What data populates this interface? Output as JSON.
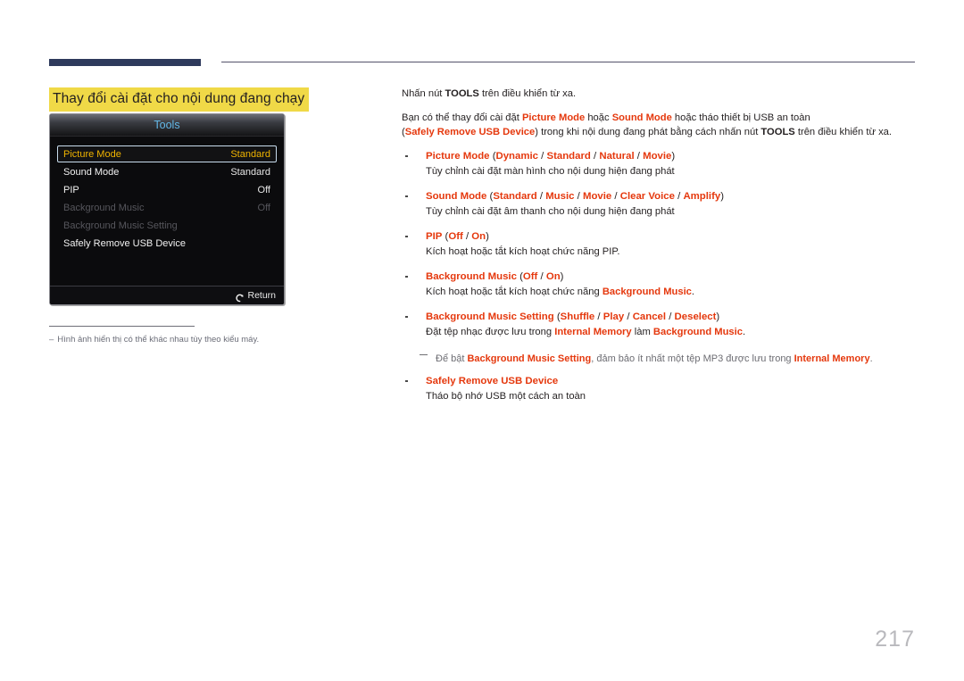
{
  "section": {
    "title": "Thay đổi cài đặt cho nội dung đang chạy"
  },
  "osd": {
    "header_title": "Tools",
    "rows": [
      {
        "label": "Picture Mode",
        "value": "Standard",
        "state": "selected"
      },
      {
        "label": "Sound Mode",
        "value": "Standard",
        "state": "normal"
      },
      {
        "label": "PIP",
        "value": "Off",
        "state": "normal"
      },
      {
        "label": "Background Music",
        "value": "Off",
        "state": "disabled"
      },
      {
        "label": "Background Music Setting",
        "value": "",
        "state": "disabled"
      },
      {
        "label": "Safely Remove USB Device",
        "value": "",
        "state": "normal"
      }
    ],
    "return_label": "Return",
    "return_icon": "return-arrow-icon"
  },
  "footnote": {
    "dash": "‒",
    "text": "Hình ảnh hiển thị có thể khác nhau tùy theo kiểu máy."
  },
  "body": {
    "p1_pre": "Nhấn nút ",
    "p1_bold": "TOOLS",
    "p1_post": " trên điều khiển từ xa.",
    "p2_a": "Bạn có thể thay đổi cài đặt ",
    "p2_r1": "Picture Mode",
    "p2_b": " hoặc ",
    "p2_r2": "Sound Mode",
    "p2_c": " hoặc tháo thiết bị USB an toàn",
    "p2_d": "(",
    "p2_r3": "Safely Remove USB Device",
    "p2_e": ") trong khi nội dung đang phát bằng cách nhấn nút ",
    "p2_bold": "TOOLS",
    "p2_f": " trên điều khiển từ xa."
  },
  "bullets": [
    {
      "name": "picture-mode",
      "head_main": "Picture Mode",
      "head_open": " (",
      "head_options": [
        "Dynamic",
        "Standard",
        "Natural",
        "Movie"
      ],
      "head_close": ")",
      "desc_plain": "Tùy chỉnh cài đặt màn hình cho nội dung hiện đang phát"
    },
    {
      "name": "sound-mode",
      "head_main": "Sound Mode",
      "head_open": " (",
      "head_options": [
        "Standard",
        "Music",
        "Movie",
        "Clear Voice",
        "Amplify"
      ],
      "head_close": ")",
      "desc_plain": "Tùy chỉnh cài đặt âm thanh cho nội dung hiện đang phát"
    },
    {
      "name": "pip",
      "head_main": "PIP",
      "head_open": " (",
      "head_options": [
        "Off",
        "On"
      ],
      "head_close": ")",
      "desc_plain": "Kích hoạt hoặc tắt kích hoạt chức năng PIP."
    },
    {
      "name": "background-music",
      "head_main": "Background Music",
      "head_open": " (",
      "head_options": [
        "Off",
        "On"
      ],
      "head_close": ")",
      "desc_pre": "Kích hoạt hoặc tắt kích hoạt chức năng ",
      "desc_r": "Background Music",
      "desc_post": "."
    },
    {
      "name": "background-music-setting",
      "head_main": "Background Music Setting",
      "head_open": " (",
      "head_options": [
        "Shuffle",
        "Play",
        "Cancel",
        "Deselect"
      ],
      "head_close": ")",
      "desc_pre": "Đặt tệp nhạc được lưu trong ",
      "desc_r": "Internal Memory",
      "desc_mid": " làm ",
      "desc_r2": "Background Music",
      "desc_post": "."
    }
  ],
  "note": {
    "pre": "Để bật ",
    "r1": "Background Music Setting",
    "mid": ", đảm bảo ít nhất một tệp MP3 được lưu trong ",
    "r2": "Internal Memory",
    "post": "."
  },
  "last_bullet": {
    "name": "safely-remove-usb-device",
    "head_main": "Safely Remove USB Device",
    "desc_plain": "Tháo bộ nhớ USB một cách an toàn"
  },
  "page": {
    "number": "217"
  },
  "colors": {
    "accent_red": "#e5380d",
    "highlight_yellow": "#f0d947",
    "rule_navy": "#2e3a5c",
    "osd_title_blue": "#63b8e8",
    "osd_selected_gold": "#f0b400"
  }
}
